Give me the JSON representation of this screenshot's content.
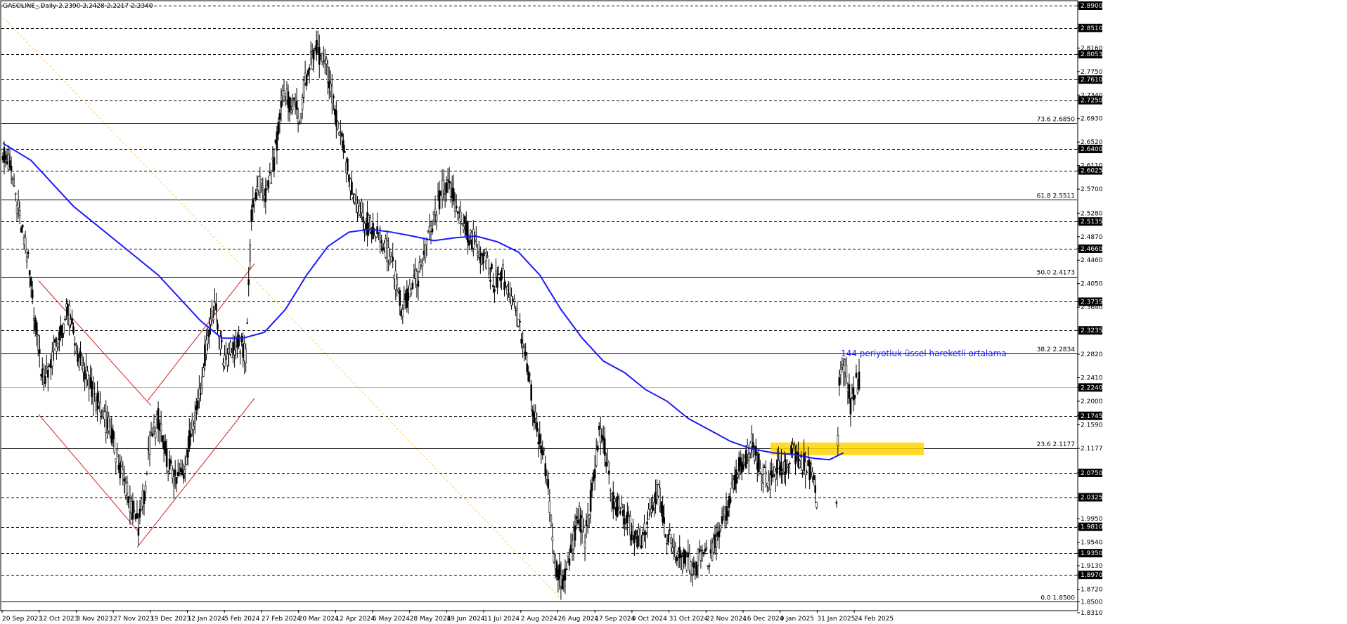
{
  "header": {
    "title": "GASOLINE_,Daily  2.2390 2.2428 2.2217 2.2340"
  },
  "chart_data": {
    "type": "candlestick",
    "symbol": "GASOLINE_",
    "timeframe": "Daily",
    "ohlc_last": {
      "open": 2.239,
      "high": 2.2428,
      "low": 2.2217,
      "close": 2.234
    },
    "ylim": [
      1.831,
      2.9
    ],
    "x_ticks": [
      "20 Sep 2023",
      "12 Oct 2023",
      "3 Nov 2023",
      "27 Nov 2023",
      "19 Dec 2023",
      "12 Jan 2024",
      "5 Feb 2024",
      "27 Feb 2024",
      "20 Mar 2024",
      "12 Apr 2024",
      "6 May 2024",
      "28 May 2024",
      "19 Jun 2024",
      "11 Jul 2024",
      "2 Aug 2024",
      "26 Aug 2024",
      "17 Sep 2024",
      "9 Oct 2024",
      "31 Oct 2024",
      "22 Nov 2024",
      "16 Dec 2024",
      "9 Jan 2025",
      "31 Jan 2025",
      "24 Feb 2025"
    ],
    "y_ticks": [
      "2.8900",
      "2.8510",
      "2.8160",
      "2.8053",
      "2.7750",
      "2.7610",
      "2.7340",
      "2.7250",
      "2.6930",
      "2.6520",
      "2.6400",
      "2.6110",
      "2.6025",
      "2.5700",
      "2.5280",
      "2.5135",
      "2.4870",
      "2.4660",
      "2.4460",
      "2.4050",
      "2.3735",
      "2.3640",
      "2.3235",
      "2.2820",
      "2.2410",
      "2.2240",
      "2.2000",
      "2.1745",
      "2.1590",
      "2.1177",
      "2.0750",
      "2.0325",
      "1.9950",
      "1.9810",
      "1.9540",
      "1.9350",
      "1.9130",
      "1.8970",
      "1.8720",
      "1.8500",
      "1.8310"
    ],
    "highlighted_levels": [
      "2.8900",
      "2.8510",
      "2.8053",
      "2.7610",
      "2.7250",
      "2.6400",
      "2.6025",
      "2.5135",
      "2.4660",
      "2.3735",
      "2.3235",
      "2.2240",
      "2.1745",
      "2.0750",
      "2.0325",
      "1.9810",
      "1.9350",
      "1.8970"
    ],
    "horizontal_levels": [
      2.89,
      2.851,
      2.8053,
      2.761,
      2.725,
      2.64,
      2.6025,
      2.5135,
      2.466,
      2.3735,
      2.3235,
      2.1745,
      2.075,
      2.0325,
      1.981,
      1.935,
      1.897
    ],
    "current_price": 2.224,
    "fibonacci": [
      {
        "label": "73.6 2.6850",
        "value": 2.685
      },
      {
        "label": "61.8 2.5511",
        "value": 2.5511
      },
      {
        "label": "50.0 2.4173",
        "value": 2.4173
      },
      {
        "label": "38.2 2.2834",
        "value": 2.2834
      },
      {
        "label": "23.6 2.1177",
        "value": 2.1177
      },
      {
        "label": "0.0 1.8500",
        "value": 1.85
      }
    ],
    "annotation": "144 periyotluk üssel hareketli ortalama",
    "colors": {
      "candles": "#000000",
      "ema": "#1a1aff",
      "channel": "#d42020",
      "trendline": "#ffd24a",
      "zone": "#ffd400",
      "grid": "#000000",
      "annotation": "#1f1fff"
    },
    "price_path": [
      [
        0,
        2.64
      ],
      [
        6,
        2.6
      ],
      [
        12,
        2.52
      ],
      [
        18,
        2.44
      ],
      [
        24,
        2.32
      ],
      [
        28,
        2.24
      ],
      [
        34,
        2.27
      ],
      [
        40,
        2.31
      ],
      [
        46,
        2.36
      ],
      [
        52,
        2.29
      ],
      [
        58,
        2.25
      ],
      [
        64,
        2.21
      ],
      [
        70,
        2.18
      ],
      [
        76,
        2.15
      ],
      [
        80,
        2.11
      ],
      [
        86,
        2.06
      ],
      [
        90,
        2.02
      ],
      [
        96,
        1.985
      ],
      [
        100,
        2.04
      ],
      [
        104,
        2.12
      ],
      [
        110,
        2.17
      ],
      [
        116,
        2.1
      ],
      [
        122,
        2.06
      ],
      [
        128,
        2.08
      ],
      [
        134,
        2.16
      ],
      [
        140,
        2.22
      ],
      [
        144,
        2.3
      ],
      [
        150,
        2.37
      ],
      [
        156,
        2.27
      ],
      [
        162,
        2.29
      ],
      [
        168,
        2.3
      ],
      [
        172,
        2.28
      ],
      [
        176,
        2.52
      ],
      [
        180,
        2.58
      ],
      [
        186,
        2.56
      ],
      [
        192,
        2.62
      ],
      [
        198,
        2.73
      ],
      [
        204,
        2.72
      ],
      [
        210,
        2.7
      ],
      [
        216,
        2.78
      ],
      [
        222,
        2.81
      ],
      [
        228,
        2.79
      ],
      [
        234,
        2.72
      ],
      [
        240,
        2.65
      ],
      [
        246,
        2.58
      ],
      [
        252,
        2.54
      ],
      [
        258,
        2.51
      ],
      [
        264,
        2.5
      ],
      [
        270,
        2.47
      ],
      [
        276,
        2.44
      ],
      [
        282,
        2.36
      ],
      [
        288,
        2.39
      ],
      [
        294,
        2.42
      ],
      [
        300,
        2.47
      ],
      [
        306,
        2.52
      ],
      [
        312,
        2.58
      ],
      [
        318,
        2.56
      ],
      [
        324,
        2.52
      ],
      [
        330,
        2.49
      ],
      [
        336,
        2.47
      ],
      [
        342,
        2.44
      ],
      [
        348,
        2.41
      ],
      [
        354,
        2.42
      ],
      [
        358,
        2.39
      ],
      [
        364,
        2.35
      ],
      [
        368,
        2.29
      ],
      [
        372,
        2.25
      ],
      [
        376,
        2.17
      ],
      [
        382,
        2.12
      ],
      [
        386,
        2.05
      ],
      [
        390,
        1.93
      ],
      [
        396,
        1.88
      ],
      [
        400,
        1.92
      ],
      [
        404,
        1.96
      ],
      [
        408,
        2.0
      ],
      [
        412,
        1.96
      ],
      [
        418,
        2.06
      ],
      [
        422,
        2.15
      ],
      [
        426,
        2.12
      ],
      [
        430,
        2.04
      ],
      [
        436,
        2.01
      ],
      [
        442,
        1.99
      ],
      [
        448,
        1.96
      ],
      [
        452,
        1.96
      ],
      [
        458,
        2.01
      ],
      [
        464,
        2.05
      ],
      [
        468,
        1.98
      ],
      [
        474,
        1.95
      ],
      [
        478,
        1.93
      ],
      [
        484,
        1.92
      ],
      [
        490,
        1.91
      ],
      [
        496,
        1.95
      ],
      [
        500,
        1.92
      ],
      [
        504,
        1.95
      ],
      [
        510,
        1.99
      ],
      [
        516,
        2.04
      ],
      [
        520,
        2.08
      ],
      [
        526,
        2.1
      ],
      [
        530,
        2.13
      ],
      [
        536,
        2.08
      ],
      [
        542,
        2.06
      ],
      [
        548,
        2.08
      ],
      [
        554,
        2.09
      ],
      [
        560,
        2.11
      ],
      [
        566,
        2.09
      ],
      [
        570,
        2.09
      ],
      [
        574,
        2.06
      ],
      [
        576,
        2.03
      ],
      [
        590,
        2.03
      ],
      [
        592,
        2.24
      ],
      [
        596,
        2.27
      ],
      [
        600,
        2.19
      ],
      [
        604,
        2.23
      ],
      [
        606,
        2.234
      ]
    ],
    "ema_144": [
      [
        0,
        2.65
      ],
      [
        20,
        2.62
      ],
      [
        50,
        2.54
      ],
      [
        80,
        2.48
      ],
      [
        110,
        2.42
      ],
      [
        140,
        2.34
      ],
      [
        155,
        2.31
      ],
      [
        170,
        2.31
      ],
      [
        185,
        2.32
      ],
      [
        200,
        2.36
      ],
      [
        215,
        2.42
      ],
      [
        230,
        2.47
      ],
      [
        245,
        2.495
      ],
      [
        260,
        2.5
      ],
      [
        275,
        2.495
      ],
      [
        290,
        2.488
      ],
      [
        305,
        2.48
      ],
      [
        320,
        2.485
      ],
      [
        335,
        2.488
      ],
      [
        350,
        2.478
      ],
      [
        365,
        2.46
      ],
      [
        380,
        2.42
      ],
      [
        395,
        2.36
      ],
      [
        410,
        2.31
      ],
      [
        425,
        2.27
      ],
      [
        440,
        2.25
      ],
      [
        455,
        2.22
      ],
      [
        470,
        2.2
      ],
      [
        485,
        2.17
      ],
      [
        500,
        2.15
      ],
      [
        515,
        2.13
      ],
      [
        530,
        2.117
      ],
      [
        545,
        2.11
      ],
      [
        560,
        2.107
      ],
      [
        575,
        2.1
      ],
      [
        585,
        2.098
      ],
      [
        595,
        2.11
      ]
    ]
  }
}
